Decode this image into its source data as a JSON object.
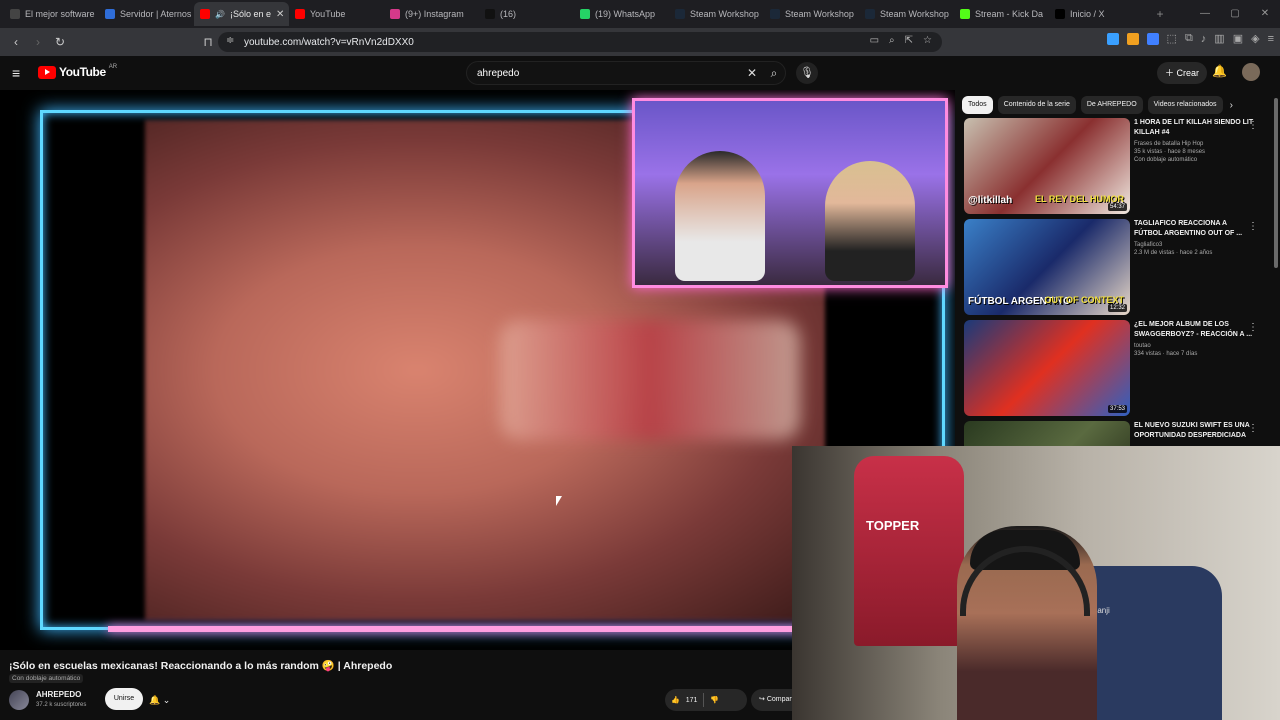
{
  "browser": {
    "tabs": [
      {
        "label": "El mejor software",
        "color": "#444"
      },
      {
        "label": "Servidor | Aternos",
        "color": "#2f6dd8"
      },
      {
        "label": "¡Sólo en e",
        "color": "#ff0000",
        "active": true
      },
      {
        "label": "YouTube",
        "color": "#ff0000"
      },
      {
        "label": "(9+) Instagram",
        "color": "#d6398a"
      },
      {
        "label": "(16)",
        "color": "#111"
      },
      {
        "label": "(19) WhatsApp",
        "color": "#25d366"
      },
      {
        "label": "Steam Workshop",
        "color": "#1b2838"
      },
      {
        "label": "Steam Workshop",
        "color": "#1b2838"
      },
      {
        "label": "Steam Workshop",
        "color": "#1b2838"
      },
      {
        "label": "Stream - Kick Da",
        "color": "#53fc18"
      },
      {
        "label": "Inicio / X",
        "color": "#000"
      }
    ],
    "url": "youtube.com/watch?v=vRnVn2dDXX0"
  },
  "youtube": {
    "logo_text": "YouTube",
    "logo_country": "AR",
    "search_query": "ahrepedo",
    "create_label": "Crear"
  },
  "video": {
    "title": "¡Sólo en escuelas mexicanas! Reaccionando a lo más random 🤪 | Ahrepedo",
    "dubbing_badge": "Con doblaje automático",
    "channel_name": "AHREPEDO",
    "subscribers": "37.2 k suscriptores",
    "join_label": "Unirse",
    "likes": "171",
    "share_label": "Compartir"
  },
  "sidebar": {
    "chips": [
      "Todos",
      "Contenido de la serie",
      "De AHREPEDO",
      "Videos relacionados"
    ],
    "recommendations": [
      {
        "title": "1 HORA DE LIT KILLAH SIENDO LIT KILLAH #4",
        "channel": "Frases de batalla Hip Hop",
        "views": "35 k vistas · hace 8 meses",
        "dub": "Con doblaje automático",
        "duration": "54:37",
        "thumb_a": "@litkillah",
        "thumb_b": "EL REY DEL HUMOR",
        "bg": "linear-gradient(135deg,#c8c0b0,#8a3030,#f0e8e0)"
      },
      {
        "title": "TAGLIAFICO REACCIONA a FÚTBOL ARGENTINO OUT OF ...",
        "channel": "Tagliafico3",
        "views": "2.3 M de vistas · hace 2 años",
        "dub": "",
        "duration": "12:32",
        "thumb_a": "FÚTBOL ARGENTINO",
        "thumb_b": "OUT OF CONTEXT",
        "bg": "linear-gradient(135deg,#3a80c8,#1a2a6a,#e8d8c8)"
      },
      {
        "title": "¿EL MEJOR ALBUM DE LOS SWAGGERBOYZ? - REACCIÓN A ...",
        "channel": "toutao",
        "views": "334 vistas · hace 7 días",
        "dub": "",
        "duration": "37:53",
        "thumb_a": "",
        "thumb_b": "",
        "bg": "linear-gradient(135deg,#1a3a7a,#e03020,#3060c0)"
      },
      {
        "title": "El nuevo Suzuki Swift es una oportunidad desperdiciada",
        "channel": "",
        "views": "",
        "dub": "",
        "duration": "",
        "thumb_a": "",
        "thumb_b": "",
        "bg": "linear-gradient(135deg,#2a3a20,#5a6a40,#1a2010)"
      }
    ]
  }
}
